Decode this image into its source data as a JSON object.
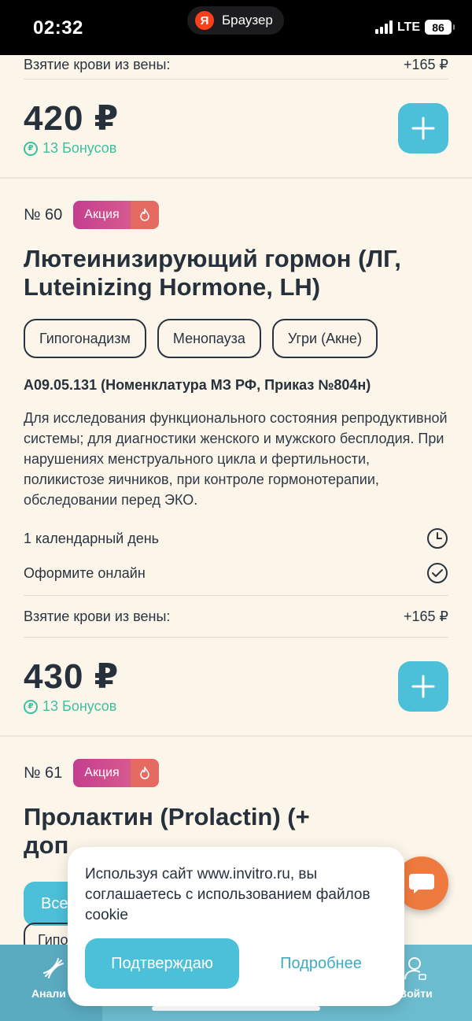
{
  "status_bar": {
    "time": "02:32",
    "browser_name": "Браузер",
    "browser_logo": "Я",
    "network": "LTE",
    "battery": "86"
  },
  "top_card": {
    "blood_draw_label": "Взятие крови из вены:",
    "blood_draw_price": "+165 ₽",
    "price": "420 ₽",
    "bonus": "13 Бонусов"
  },
  "card_60": {
    "number": "№ 60",
    "promo_label": "Акция",
    "title": "Лютеинизирующий гормон (ЛГ, Luteinizing Hormone, LH)",
    "tags": [
      "Гипогонадизм",
      "Менопауза",
      "Угри (Акне)"
    ],
    "code": "A09.05.131 (Номенклатура МЗ РФ, Приказ №804н)",
    "description": "Для исследования функционального состояния репродуктивной системы; для диагностики женского и мужского бесплодия. При нарушениях менструального цикла и фертильности, поликистозе яичников, при контроле гормонотерапии, обследовании перед ЭКО.",
    "duration": "1 календарный день",
    "order_online": "Оформите онлайн",
    "blood_draw_label": "Взятие крови из вены:",
    "blood_draw_price": "+165 ₽",
    "price": "430 ₽",
    "bonus": "13 Бонусов"
  },
  "card_61": {
    "number": "№ 61",
    "promo_label": "Акция",
    "title_line1": "Пролактин (Prolactin) (+",
    "title_line2": "доп",
    "button_partial": "Все",
    "tag_partial": "Гипо"
  },
  "bottom_nav": {
    "left_label": "Анали",
    "right_label": "Войти"
  },
  "cookie_popup": {
    "text": "Используя сайт www.invitro.ru, вы соглашаетесь с использованием файлов cookie",
    "confirm_label": "Подтверждаю",
    "more_label": "Подробнее"
  },
  "colors": {
    "accent": "#4cbfd9",
    "bonus": "#3fbfa0",
    "promo": "#c53d8f",
    "chat": "#ef7a3f",
    "background": "#fbf5ea"
  }
}
